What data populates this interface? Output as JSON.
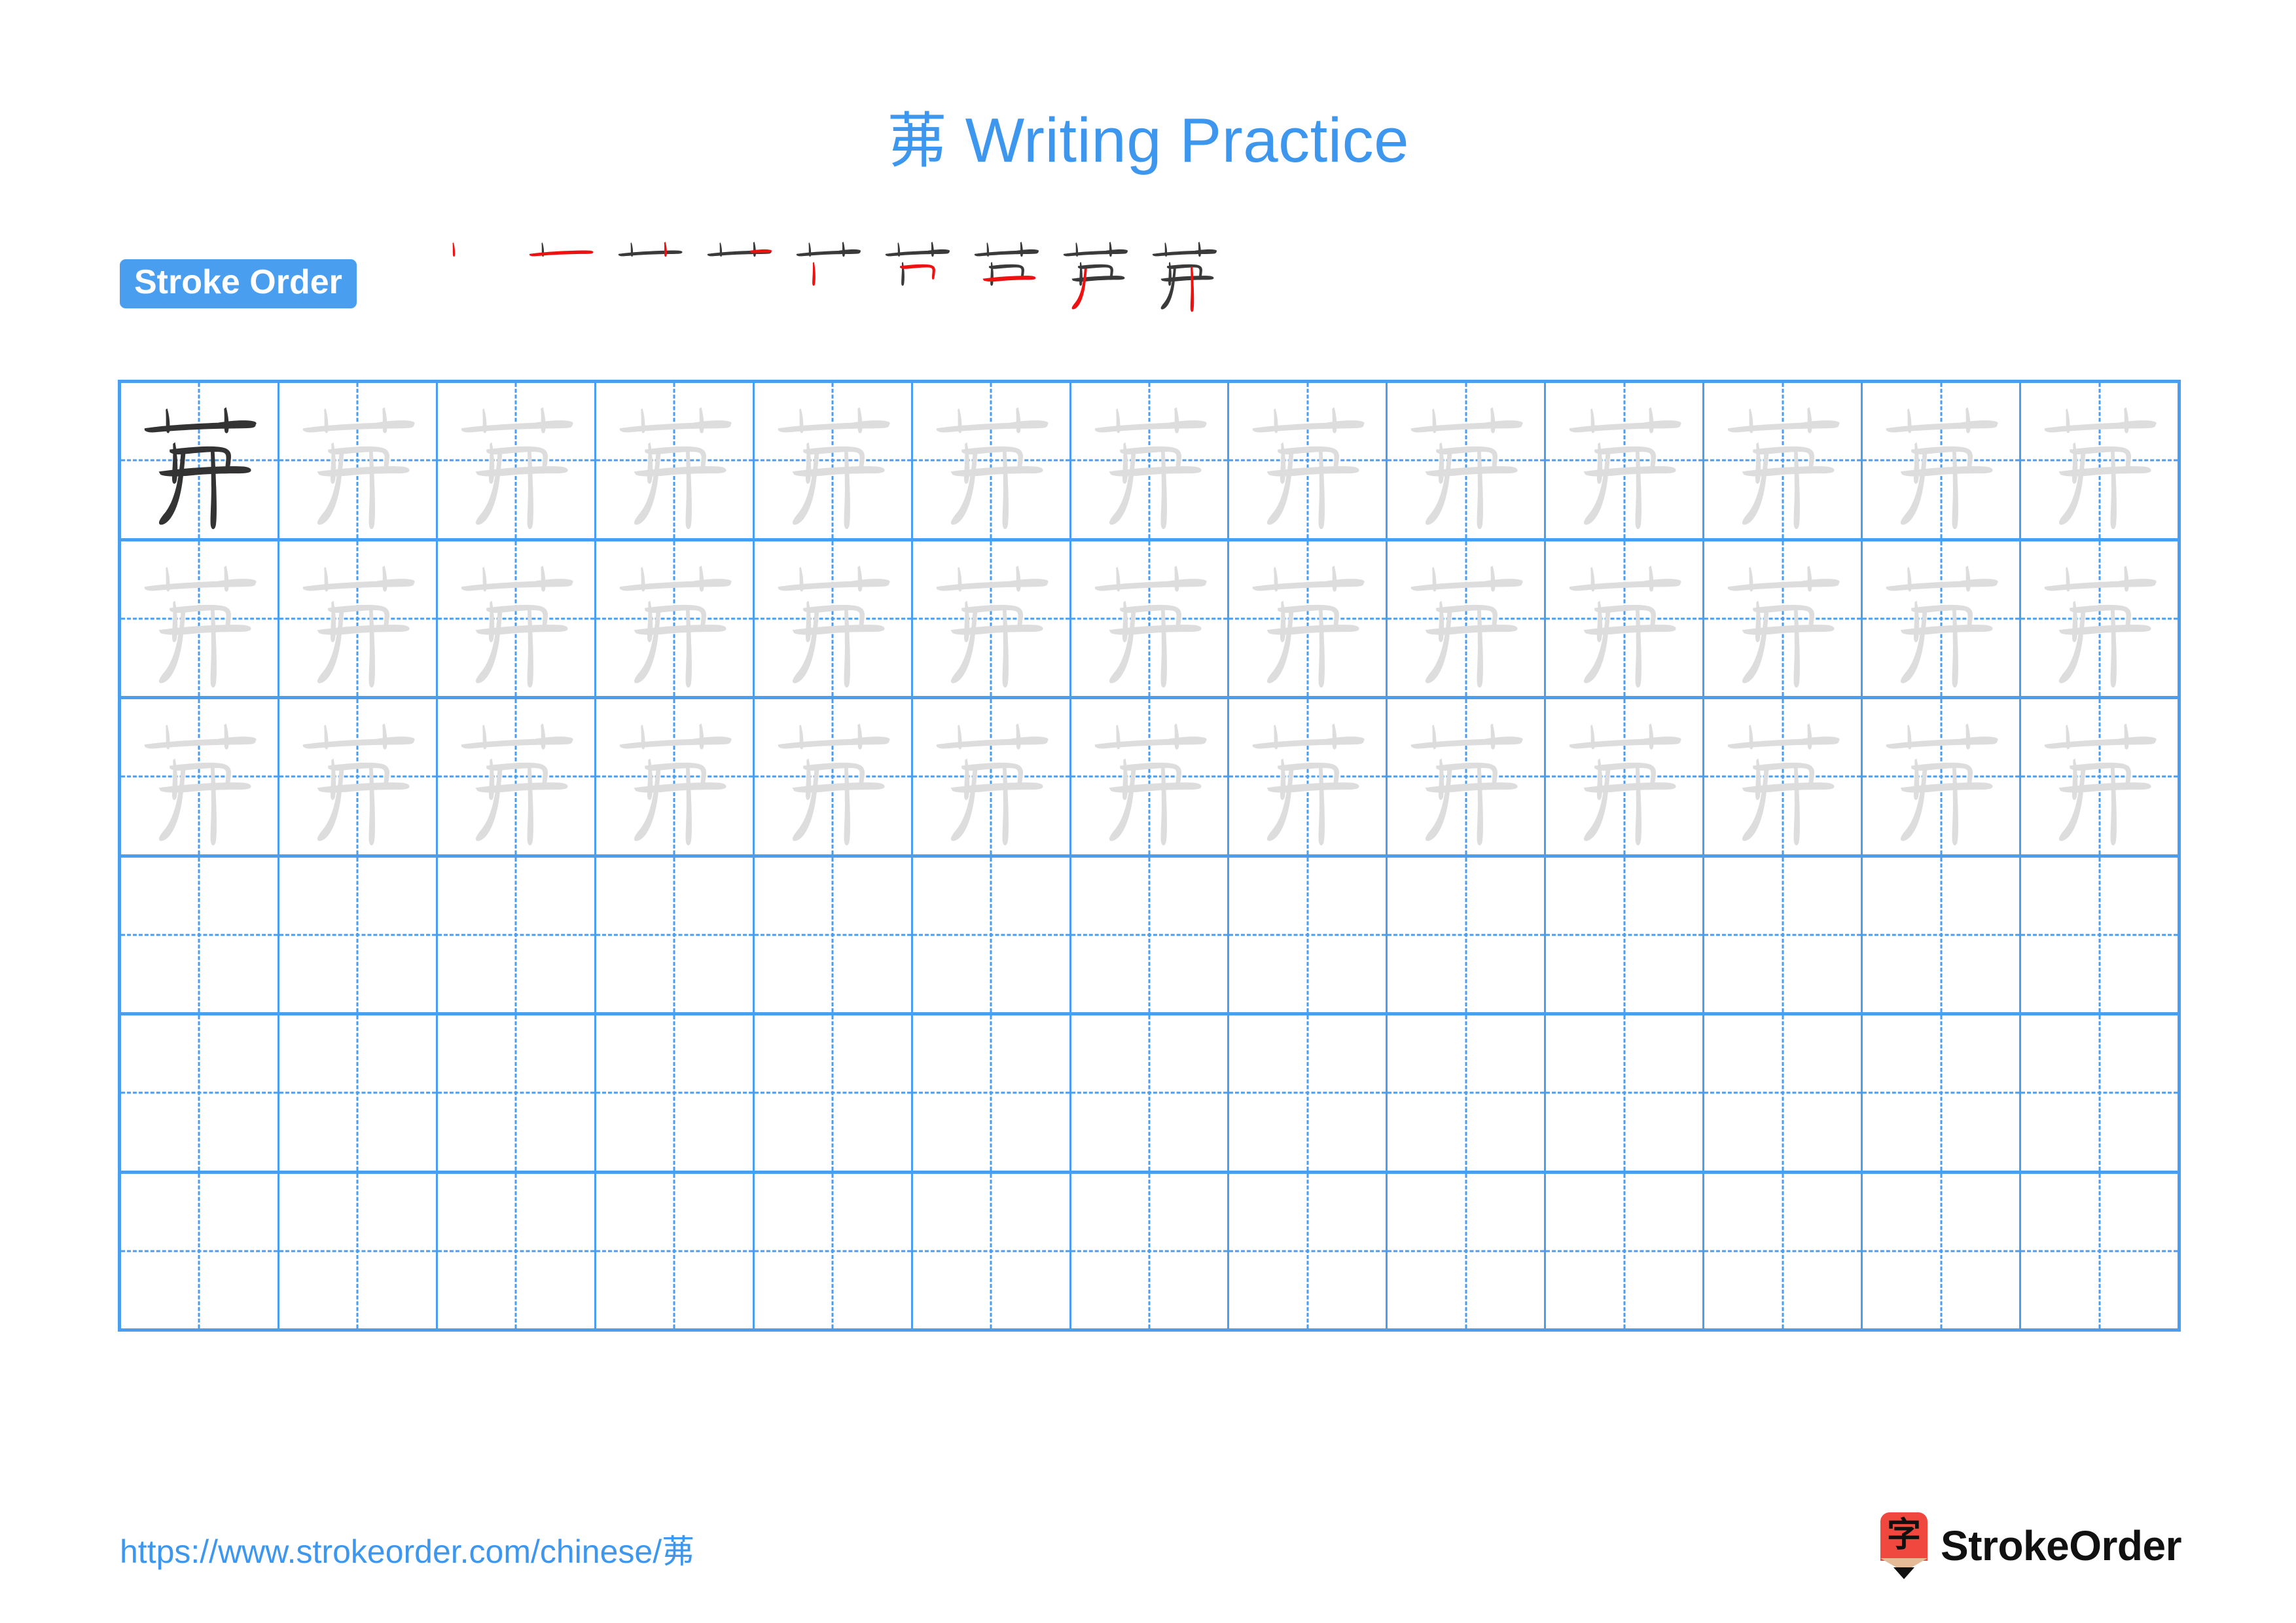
{
  "page": {
    "character": "茀",
    "title": "茀 Writing Practice",
    "title_character": "茀",
    "title_text": "Writing Practice",
    "background_color": "#ffffff",
    "accent_color": "#3d97ef",
    "grid_line_color": "#4a9eef",
    "model_glyph_color": "#333333",
    "trace_glyph_color": "#dddddd",
    "new_stroke_color": "#ee1111",
    "prior_stroke_color": "#3a3a3a"
  },
  "stroke_order": {
    "badge_label": "Stroke Order",
    "total_strokes": 9,
    "steps": [
      {
        "index": 1,
        "strokes_shown": 1,
        "new_stroke": 1,
        "label": "stroke-1"
      },
      {
        "index": 2,
        "strokes_shown": 2,
        "new_stroke": 2,
        "label": "stroke-2"
      },
      {
        "index": 3,
        "strokes_shown": 3,
        "new_stroke": 3,
        "label": "stroke-3"
      },
      {
        "index": 4,
        "strokes_shown": 4,
        "new_stroke": 4,
        "label": "stroke-4"
      },
      {
        "index": 5,
        "strokes_shown": 5,
        "new_stroke": 5,
        "label": "stroke-5"
      },
      {
        "index": 6,
        "strokes_shown": 6,
        "new_stroke": 6,
        "label": "stroke-6"
      },
      {
        "index": 7,
        "strokes_shown": 7,
        "new_stroke": 7,
        "label": "stroke-7"
      },
      {
        "index": 8,
        "strokes_shown": 8,
        "new_stroke": 8,
        "label": "stroke-8"
      },
      {
        "index": 9,
        "strokes_shown": 9,
        "new_stroke": 9,
        "label": "stroke-9"
      }
    ]
  },
  "practice_grid": {
    "columns": 13,
    "rows": 6,
    "rows_detail": [
      {
        "row": 1,
        "cells": [
          "model",
          "trace",
          "trace",
          "trace",
          "trace",
          "trace",
          "trace",
          "trace",
          "trace",
          "trace",
          "trace",
          "trace",
          "trace"
        ]
      },
      {
        "row": 2,
        "cells": [
          "trace",
          "trace",
          "trace",
          "trace",
          "trace",
          "trace",
          "trace",
          "trace",
          "trace",
          "trace",
          "trace",
          "trace",
          "trace"
        ]
      },
      {
        "row": 3,
        "cells": [
          "trace",
          "trace",
          "trace",
          "trace",
          "trace",
          "trace",
          "trace",
          "trace",
          "trace",
          "trace",
          "trace",
          "trace",
          "trace"
        ]
      },
      {
        "row": 4,
        "cells": [
          "empty",
          "empty",
          "empty",
          "empty",
          "empty",
          "empty",
          "empty",
          "empty",
          "empty",
          "empty",
          "empty",
          "empty",
          "empty"
        ]
      },
      {
        "row": 5,
        "cells": [
          "empty",
          "empty",
          "empty",
          "empty",
          "empty",
          "empty",
          "empty",
          "empty",
          "empty",
          "empty",
          "empty",
          "empty",
          "empty"
        ]
      },
      {
        "row": 6,
        "cells": [
          "empty",
          "empty",
          "empty",
          "empty",
          "empty",
          "empty",
          "empty",
          "empty",
          "empty",
          "empty",
          "empty",
          "empty",
          "empty"
        ]
      }
    ]
  },
  "footer": {
    "url": "https://www.strokeorder.com/chinese/茀",
    "brand_name": "StrokeOrder",
    "brand_mark_character": "字"
  }
}
